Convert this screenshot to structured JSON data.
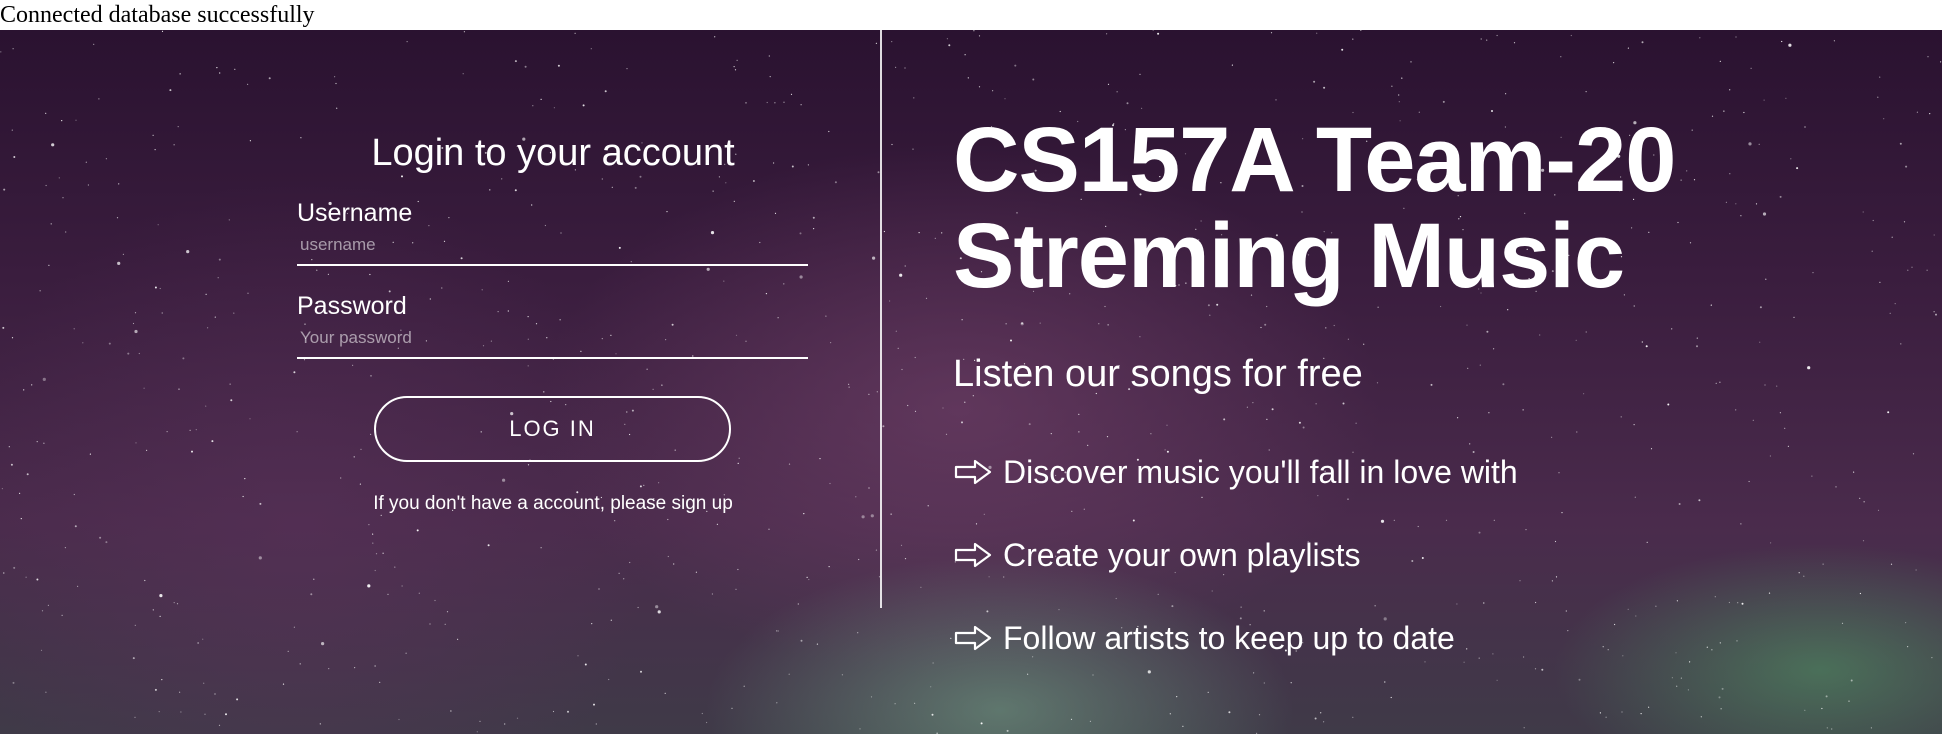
{
  "status": {
    "message": "Connected database successfully"
  },
  "login": {
    "title": "Login to your account",
    "username_label": "Username",
    "username_placeholder": "username",
    "username_value": "",
    "password_label": "Password",
    "password_placeholder": "Your password",
    "password_value": "",
    "button_label": "LOG IN",
    "signup_text": "If you don't have a account, please sign up"
  },
  "hero": {
    "headline_line1": "CS157A Team-20",
    "headline_line2": "Streming Music",
    "tagline": "Listen our songs for free",
    "features": [
      {
        "icon": "arrow-right-icon",
        "text": "Discover music you'll fall in love with"
      },
      {
        "icon": "arrow-right-icon",
        "text": "Create your own playlists"
      },
      {
        "icon": "arrow-right-icon",
        "text": "Follow artists to keep up to date"
      }
    ]
  },
  "colors": {
    "background_top": "#2a1230",
    "background_bottom": "#3f3a48",
    "aurora_green": "#50a064",
    "text": "#ffffff"
  }
}
